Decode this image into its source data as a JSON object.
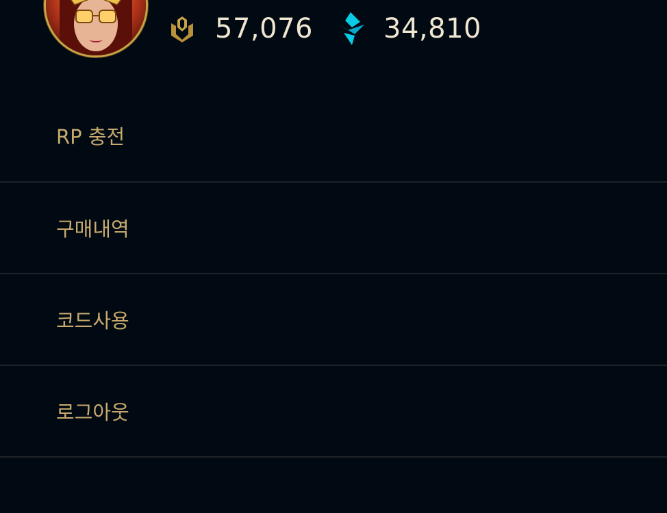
{
  "header": {
    "avatar": {
      "alt": "player-avatar"
    },
    "rp": {
      "icon": "riot-points-icon",
      "amount": "57,076"
    },
    "be": {
      "icon": "blue-essence-icon",
      "amount": "34,810"
    }
  },
  "menu": {
    "items": [
      {
        "label": "RP 충전"
      },
      {
        "label": "구매내역"
      },
      {
        "label": "코드사용"
      },
      {
        "label": "로그아웃"
      }
    ]
  },
  "colors": {
    "background": "#010a13",
    "gold_text": "#c8aa6e",
    "amount_text": "#f0e6d2",
    "divider": "#1e2328",
    "be_cyan": "#0acbe6",
    "avatar_ring": "#c8a348"
  }
}
